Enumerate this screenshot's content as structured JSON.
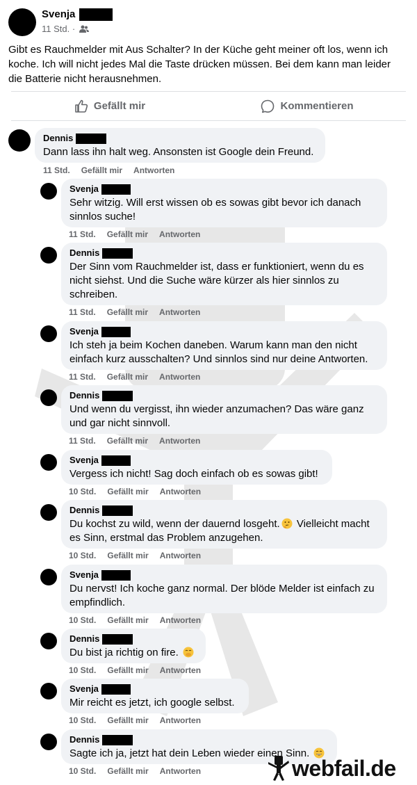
{
  "post": {
    "author": "Svenja",
    "time": "11 Std.",
    "separator": "·",
    "audience_icon": "friends-icon",
    "text": "Gibt es Rauchmelder mit Aus Schalter? In der Küche geht meiner oft los, wenn ich koche. Ich will nicht jedes Mal die Taste drücken müssen. Bei dem kann man leider die Batterie nicht herausnehmen."
  },
  "actions": {
    "like": "Gefällt mir",
    "comment": "Kommentieren"
  },
  "comment_actions": {
    "like": "Gefällt mir",
    "reply": "Antworten"
  },
  "comments": [
    {
      "author": "Dennis",
      "text": "Dann lass ihn halt weg. Ansonsten ist Google dein Freund.",
      "time": "11 Std."
    },
    {
      "author": "Svenja",
      "text": "Sehr witzig. Will erst wissen ob es sowas gibt bevor ich danach sinnlos suche!",
      "time": "11 Std."
    },
    {
      "author": "Dennis",
      "text": "Der Sinn vom Rauchmelder ist, dass er funktioniert, wenn du es nicht siehst. Und die Suche wäre kürzer als hier sinnlos zu schreiben.",
      "time": "11 Std."
    },
    {
      "author": "Svenja",
      "text": "Ich steh ja beim Kochen daneben. Warum kann man den nicht einfach kurz ausschalten? Und sinnlos sind nur deine Antworten.",
      "time": "11 Std."
    },
    {
      "author": "Dennis",
      "text": "Und wenn du vergisst, ihn wieder anzumachen? Das wäre ganz und gar nicht sinnvoll.",
      "time": "11 Std."
    },
    {
      "author": "Svenja",
      "text": "Vergess ich nicht! Sag doch einfach ob es sowas gibt!",
      "time": "10 Std."
    },
    {
      "author": "Dennis",
      "text": "Du kochst zu wild, wenn der dauernd losgeht.",
      "emoji": "thinking-face-emoji",
      "text2": " Vielleicht macht es Sinn, erstmal das Problem anzugehen.",
      "time": "10 Std."
    },
    {
      "author": "Svenja",
      "text": "Du nervst! Ich koche ganz normal. Der blöde Melder ist einfach zu empfindlich.",
      "time": "10 Std."
    },
    {
      "author": "Dennis",
      "text": "Du bist ja richtig on fire. ",
      "emoji": "hand-over-mouth-emoji",
      "time": "10 Std."
    },
    {
      "author": "Svenja",
      "text": "Mir reicht es jetzt, ich google selbst.",
      "time": "10 Std."
    },
    {
      "author": "Dennis",
      "text": "Sagte ich ja, jetzt hat dein Leben wieder einen Sinn. ",
      "emoji": "grinning-face-emoji",
      "time": "10 Std."
    }
  ],
  "branding": {
    "logo_text": "webfail.de",
    "watermark_icon": "webfail-mascot-icon"
  }
}
